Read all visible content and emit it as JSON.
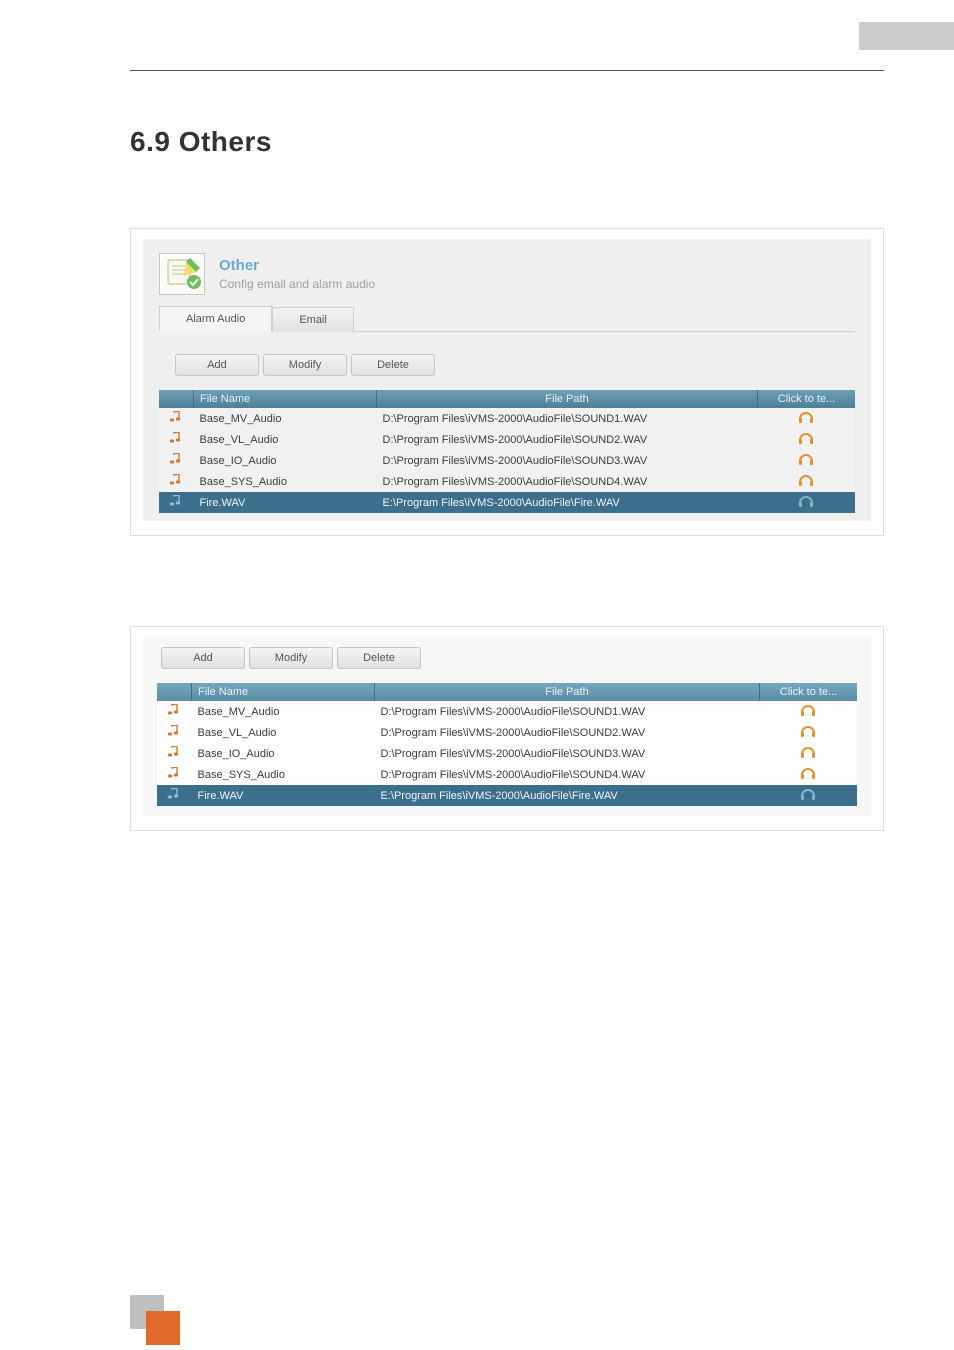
{
  "heading": "6.9  Others",
  "panel": {
    "title": "Other",
    "subtitle": "Config email and alarm audio",
    "tabs": [
      "Alarm Audio",
      "Email"
    ]
  },
  "toolbar": [
    "Add",
    "Modify",
    "Delete"
  ],
  "columns": {
    "name": "File Name",
    "path": "File Path",
    "play": "Click to te..."
  },
  "rows": [
    {
      "name": "Base_MV_Audio",
      "path": "D:\\Program Files\\iVMS-2000\\AudioFile\\SOUND1.WAV",
      "sel": false
    },
    {
      "name": "Base_VL_Audio",
      "path": "D:\\Program Files\\iVMS-2000\\AudioFile\\SOUND2.WAV",
      "sel": false
    },
    {
      "name": "Base_IO_Audio",
      "path": "D:\\Program Files\\iVMS-2000\\AudioFile\\SOUND3.WAV",
      "sel": false
    },
    {
      "name": "Base_SYS_Audio",
      "path": "D:\\Program Files\\iVMS-2000\\AudioFile\\SOUND4.WAV",
      "sel": false
    },
    {
      "name": "Fire.WAV",
      "path": "E:\\Program Files\\iVMS-2000\\AudioFile\\Fire.WAV",
      "sel": true
    }
  ],
  "icons": {
    "note": "music-note-icon",
    "headphones": "headphones-icon",
    "other": "pencil-note-icon"
  }
}
